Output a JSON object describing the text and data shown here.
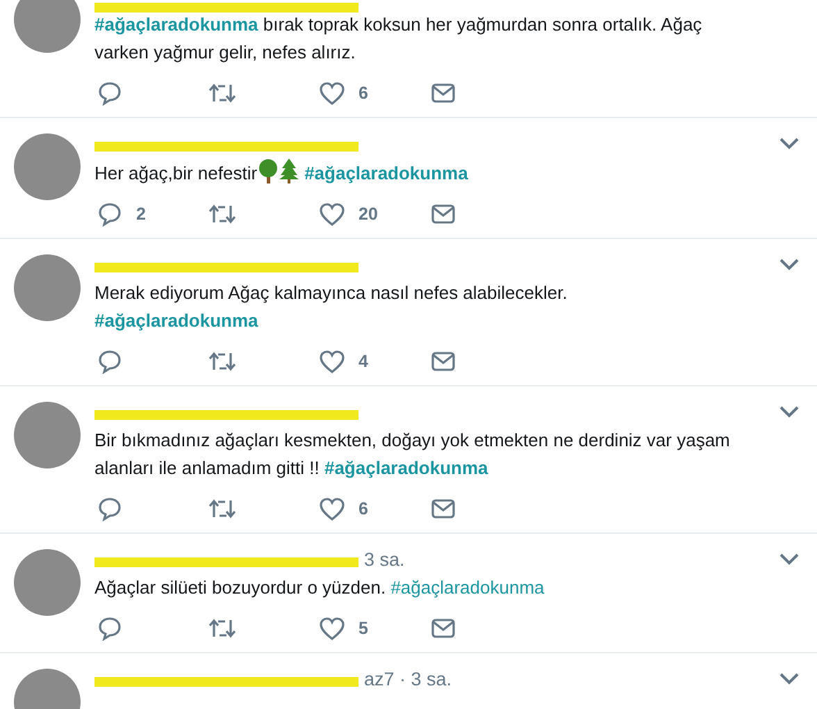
{
  "tweets": [
    {
      "segments": [
        {
          "kind": "hashtag",
          "text": "#ağaçlaradokunma",
          "bold": true
        },
        {
          "kind": "text",
          "text": " bırak toprak koksun her yağmurdan sonra ortalık. Ağaç varken yağmur gelir, nefes alırız."
        }
      ],
      "likes": "6"
    },
    {
      "segments": [
        {
          "kind": "text",
          "text": "Her ağaç,bir nefestir"
        },
        {
          "kind": "trees"
        },
        {
          "kind": "hashtag",
          "text": "#ağaçlaradokunma",
          "bold": true
        }
      ],
      "replies": "2",
      "likes": "20"
    },
    {
      "segments": [
        {
          "kind": "text",
          "text": "Merak ediyorum Ağaç kalmayınca nasıl nefes alabilecekler."
        },
        {
          "kind": "break"
        },
        {
          "kind": "hashtag",
          "text": "#ağaçlaradokunma",
          "bold": true
        }
      ],
      "likes": "4"
    },
    {
      "segments": [
        {
          "kind": "text",
          "text": "Bir bıkmadınız ağaçları kesmekten, doğayı yok etmekten ne derdiniz var yaşam alanları ile anlamadım gitti !! "
        },
        {
          "kind": "hashtag",
          "text": "#ağaçlaradokunma",
          "bold": true
        }
      ],
      "likes": "6"
    },
    {
      "meta": "3 sa.",
      "segments": [
        {
          "kind": "text",
          "text": "Ağaçlar silüeti bozuyordur o yüzden.  "
        },
        {
          "kind": "hashtag",
          "text": "#ağaçlaradokunma",
          "bold": false
        }
      ],
      "likes": "5"
    },
    {
      "meta": "az7 · 3 sa."
    }
  ]
}
